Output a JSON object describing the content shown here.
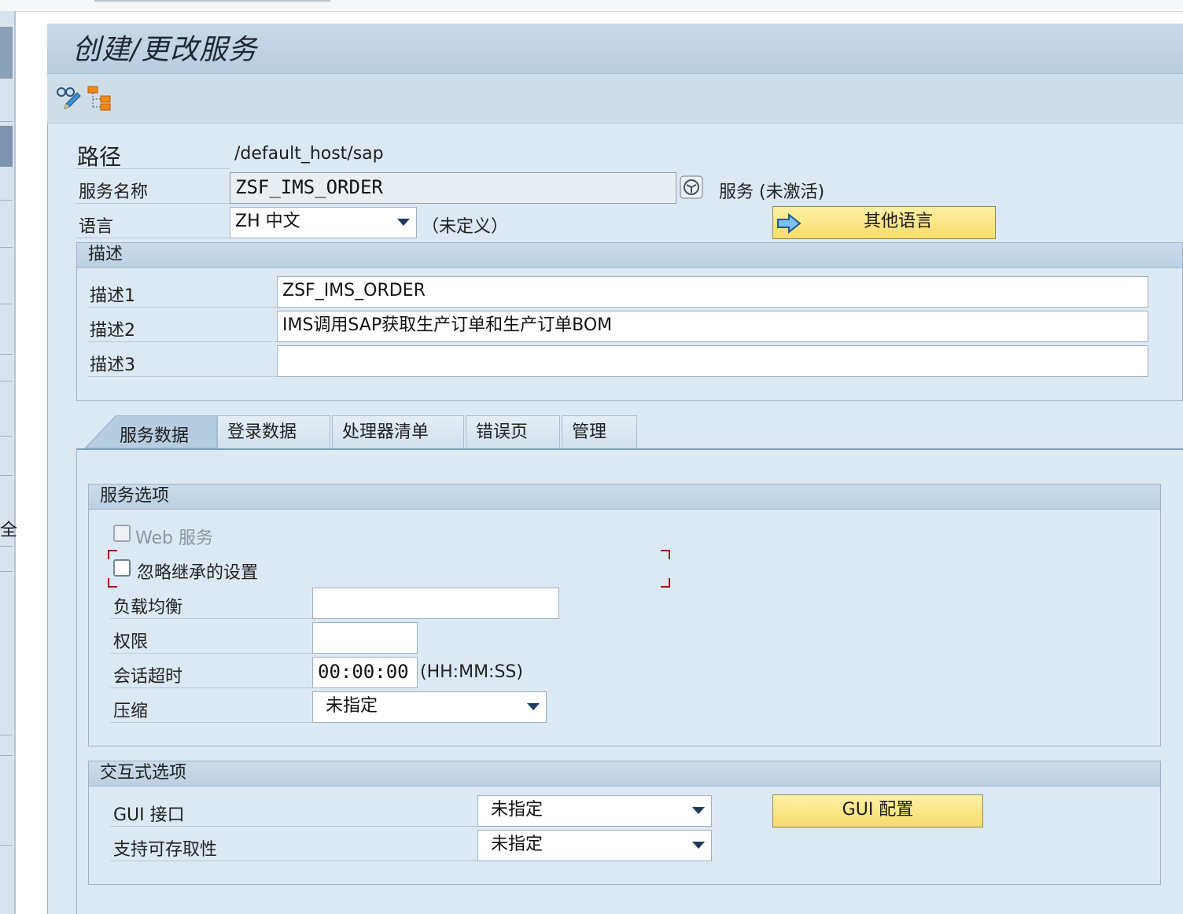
{
  "window": {
    "title": "创建/更改服务"
  },
  "toolbar": {
    "icons": [
      "display-change-icon",
      "hierarchy-icon"
    ]
  },
  "header": {
    "path_label": "路径",
    "path_value": "/default_host/sap",
    "service_name_label": "服务名称",
    "service_name_value": "ZSF_IMS_ORDER",
    "service_status": "服务 (未激活)",
    "language_label": "语言",
    "language_value": "ZH 中文",
    "language_note": "（未定义）",
    "other_lang_button": "其他语言"
  },
  "description": {
    "title": "描述",
    "rows": [
      {
        "label": "描述1",
        "value": "ZSF_IMS_ORDER"
      },
      {
        "label": "描述2",
        "value": "IMS调用SAP获取生产订单和生产订单BOM"
      },
      {
        "label": "描述3",
        "value": ""
      }
    ]
  },
  "tabs": [
    "服务数据",
    "登录数据",
    "处理器清单",
    "错误页",
    "管理"
  ],
  "active_tab": "服务数据",
  "service_options": {
    "title": "服务选项",
    "web_service_label": "Web 服务",
    "web_service_checked": false,
    "ignore_inherit_label": "忽略继承的设置",
    "ignore_inherit_checked": false,
    "load_balance_label": "负载均衡",
    "load_balance_value": "",
    "auth_label": "权限",
    "auth_value": "",
    "session_timeout_label": "会话超时",
    "session_timeout_value": "00:00:00",
    "session_timeout_format": "(HH:MM:SS)",
    "compression_label": "压缩",
    "compression_value": "未指定"
  },
  "interactive_options": {
    "title": "交互式选项",
    "gui_interface_label": "GUI 接口",
    "gui_interface_value": "未指定",
    "accessibility_label": "支持可存取性",
    "accessibility_value": "未指定",
    "gui_config_button": "GUI 配置"
  },
  "side": {
    "char": "全"
  },
  "colors": {
    "button_yellow": "#f7dc6b",
    "frame_blue": "#dce8f3",
    "title_blue": "#b9cde0"
  }
}
